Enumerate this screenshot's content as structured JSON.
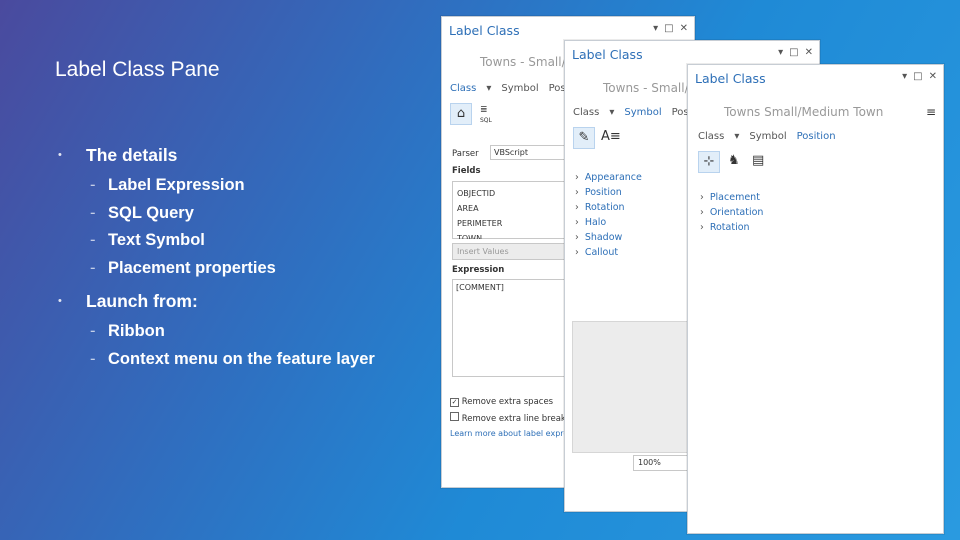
{
  "slide": {
    "title": "Label Class Pane",
    "bullet1": "The details",
    "sub1": [
      "Label Expression",
      "SQL Query",
      "Text Symbol",
      "Placement properties"
    ],
    "bullet2": "Launch from:",
    "sub2": [
      "Ribbon",
      "Context menu on the feature layer"
    ]
  },
  "pane1": {
    "title": "Label Class",
    "layer": "Towns - Small/",
    "tabs": [
      "Class",
      "Symbol",
      "Pos"
    ],
    "parser_label": "Parser",
    "parser_value": "VBScript",
    "fields_label": "Fields",
    "fields": [
      "OBJECTID",
      "AREA",
      "PERIMETER",
      "TOWN"
    ],
    "insert_values": "Insert Values",
    "expression_label": "Expression",
    "expression_value": "[COMMENT]",
    "remove_spaces": "Remove extra spaces",
    "remove_breaks": "Remove extra line breaks",
    "learn_more": "Learn more about label expre"
  },
  "pane2": {
    "title": "Label Class",
    "layer": "Towns - Small/",
    "tabs": [
      "Class",
      "Symbol",
      "Pos"
    ],
    "props": [
      "Appearance",
      "Position",
      "Rotation",
      "Halo",
      "Shadow",
      "Callout"
    ],
    "zoom": "100%"
  },
  "pane3": {
    "title": "Label Class",
    "layer": "Towns  Small/Medium Town",
    "tabs": [
      "Class",
      "Symbol",
      "Position"
    ],
    "props": [
      "Placement",
      "Orientation",
      "Rotation"
    ]
  },
  "icons": {
    "window_controls": [
      "chevron-down-icon",
      "restore-icon",
      "close-icon"
    ],
    "pane1_tools": [
      "class-icon",
      "sql-icon"
    ],
    "pane2_tools": [
      "brush-icon",
      "text-symbol-icon"
    ],
    "pane3_tools": [
      "placement-icon",
      "chess-icon",
      "text-box-icon"
    ]
  }
}
